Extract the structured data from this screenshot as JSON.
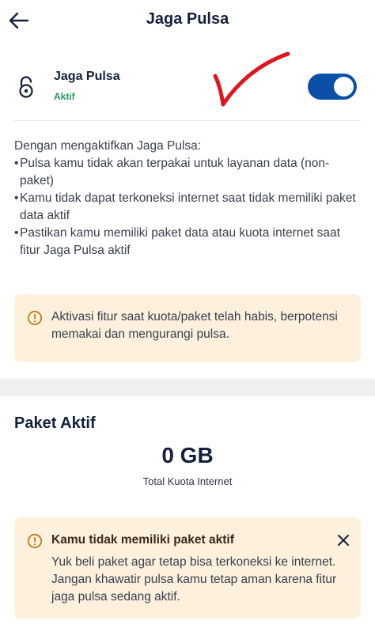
{
  "header": {
    "title": "Jaga Pulsa",
    "back_icon": "arrow-left-icon"
  },
  "feature": {
    "name": "Jaga Pulsa",
    "status": "Aktif",
    "icon": "unlock-icon",
    "toggle_on": true,
    "status_color": "#1f9d55",
    "toggle_color": "#0b4fa8"
  },
  "description": {
    "intro": "Dengan mengaktifkan Jaga Pulsa:",
    "items": [
      "Pulsa kamu tidak akan terpakai untuk layanan data (non-paket)",
      "Kamu tidak dapat terkoneksi internet saat tidak memiliki paket data aktif",
      "Pastikan kamu memiliki paket data atau kuota internet saat fitur Jaga Pulsa aktif"
    ],
    "bullet": "•"
  },
  "activation_warning": {
    "icon": "info-circle-icon",
    "text": "Aktivasi fitur saat kuota/paket telah habis, berpotensi memakai dan mengurangi pulsa."
  },
  "active_package": {
    "section_title": "Paket Aktif",
    "quota_value": "0 GB",
    "quota_label": "Total Kuota Internet"
  },
  "no_package_alert": {
    "icon": "info-circle-icon",
    "title": "Kamu tidak memiliki paket aktif",
    "text": "Yuk beli paket agar tetap bisa terkoneksi ke internet. Jangan khawatir pulsa kamu tetap aman karena fitur jaga pulsa sedang aktif.",
    "close_icon": "close-icon"
  },
  "colors": {
    "warning_bg": "#fdf0dd",
    "annotation_red": "#e0141e"
  }
}
